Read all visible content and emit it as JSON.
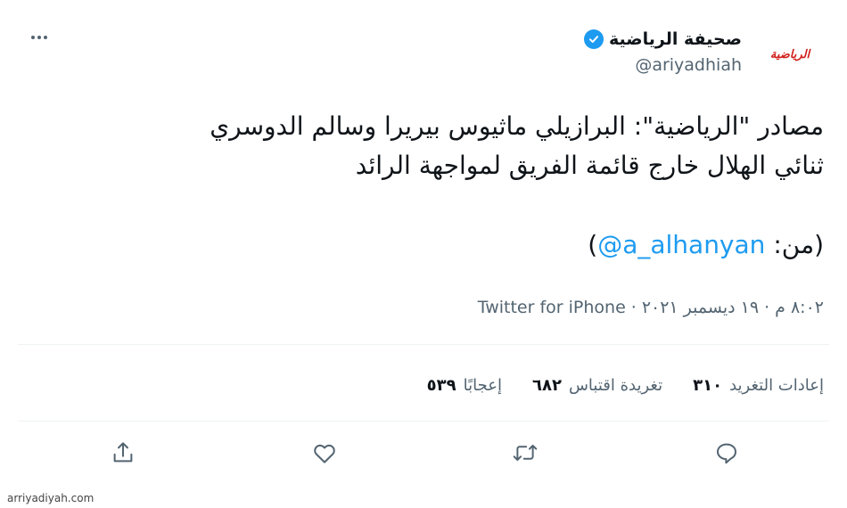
{
  "author": {
    "avatar_text": "الرياضية",
    "display_name": "صحيفة الرياضية",
    "handle": "@ariyadhiah",
    "verified": true
  },
  "tweet": {
    "lines": [
      "مصادر \"الرياضية\": البرازيلي ماثيوس بيريرا وسالم الدوسري",
      "ثنائي الهلال خارج قائمة الفريق لمواجهة الرائد"
    ],
    "credit_open": "(من: ",
    "credit_mention": "@a_alhanyan",
    "credit_close": ")"
  },
  "meta": {
    "time_date": "٨:٠٢ م · ١٩ ديسمبر ٢٠٢١",
    "separator": "·",
    "source": "Twitter for iPhone"
  },
  "stats": {
    "retweets_count": "٣١٠",
    "retweets_label": "إعادات التغريد",
    "quotes_count": "٦٨٢",
    "quotes_label": "تغريدة اقتباس",
    "likes_count": "٥٣٩",
    "likes_label": "إعجابًا"
  },
  "actions": [
    "reply-icon",
    "retweet-icon",
    "like-icon",
    "share-icon"
  ],
  "watermark": "arriyadiyah.com",
  "colors": {
    "accent": "#1d9bf0",
    "text": "#0f1419",
    "secondary": "#536471",
    "logo_red": "#d0211c",
    "divider": "#eff3f4"
  }
}
